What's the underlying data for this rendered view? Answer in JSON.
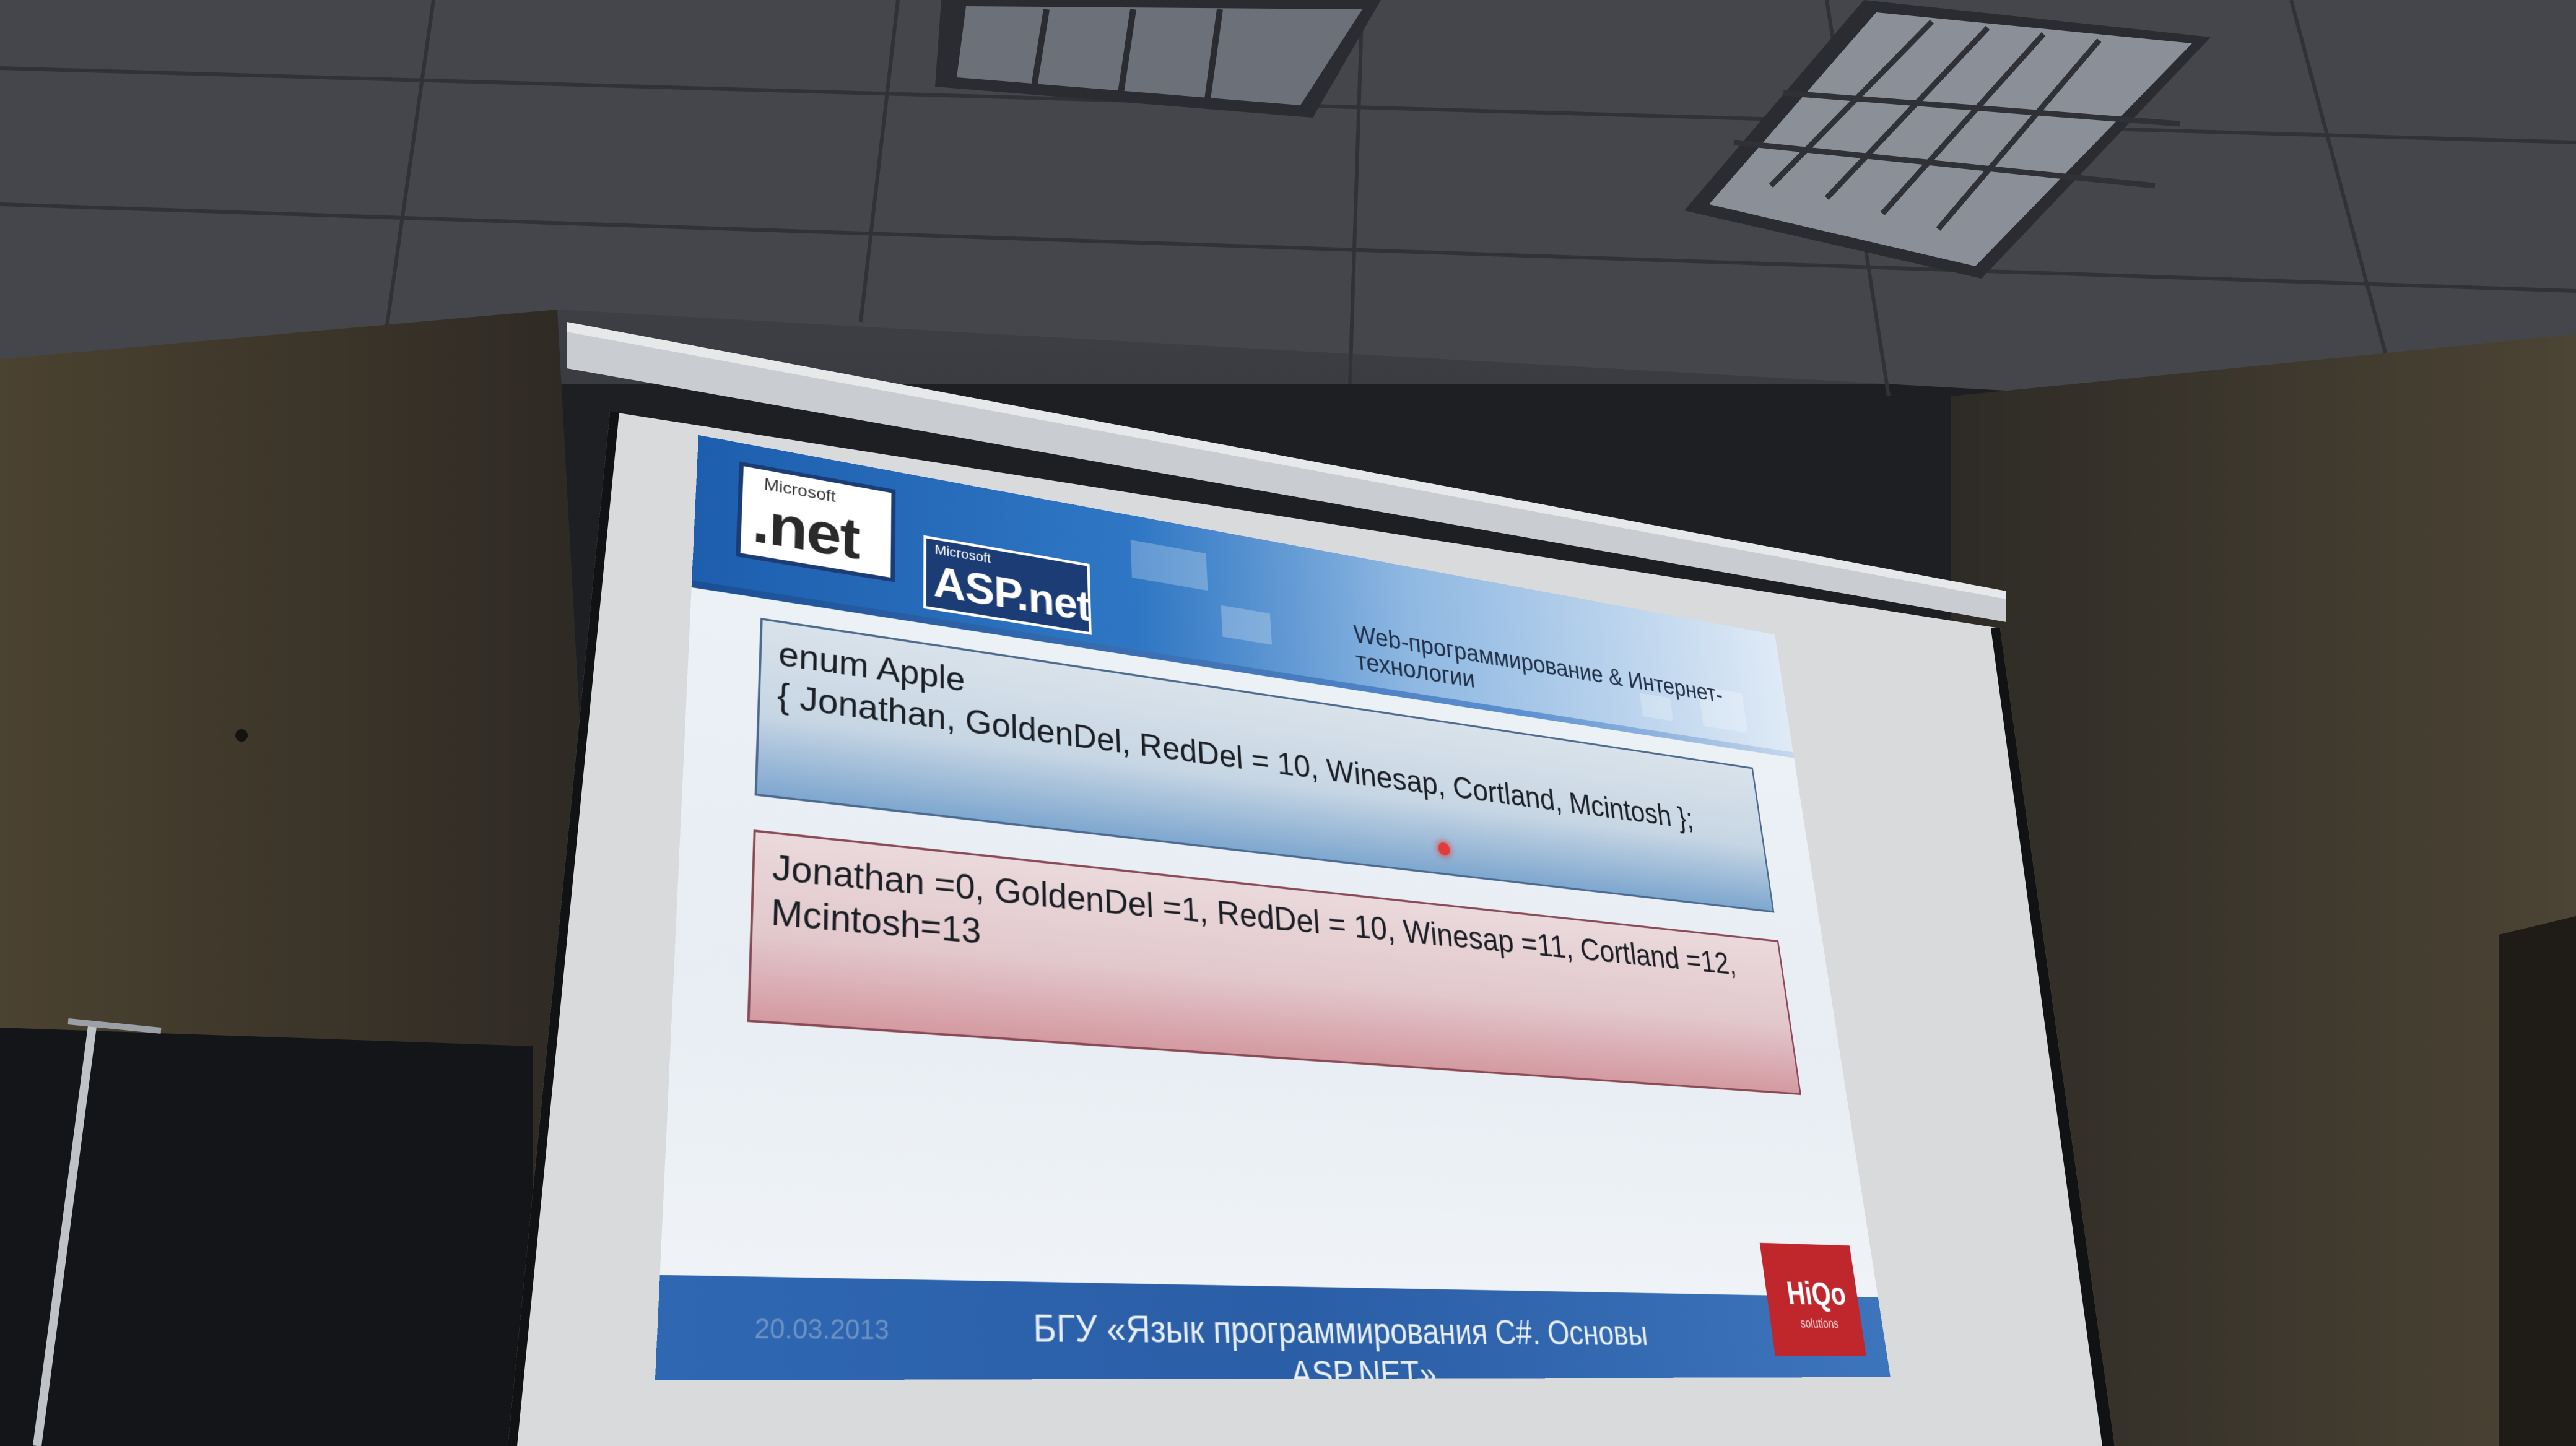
{
  "slide": {
    "logos": {
      "net": {
        "vendor": "Microsoft",
        "mark": ".net"
      },
      "asp": {
        "vendor": "Microsoft",
        "mark": "ASP.net"
      }
    },
    "course_title": "Web-программирование & Интернет-технологии",
    "code_box": {
      "line1": "enum Apple",
      "line2": "{ Jonathan, GoldenDel, RedDel = 10, Winesap, Cortland, Mcintosh };"
    },
    "result_box": {
      "text": "Jonathan =0, GoldenDel =1, RedDel = 10, Winesap =11, Cortland =12, Mcintosh=13"
    },
    "footer": {
      "date": "20.03.2013",
      "caption": "БГУ «Язык программирования C#. Основы ASP.NET»"
    },
    "brand_badge": {
      "name": "HiQo",
      "tagline": "solutions"
    }
  },
  "colors": {
    "header_blue": "#1d5fae",
    "code_box_blue": "#7fa7cf",
    "result_box_red": "#d49aa1",
    "badge_red": "#c0272d",
    "laser": "#e33b3b"
  }
}
